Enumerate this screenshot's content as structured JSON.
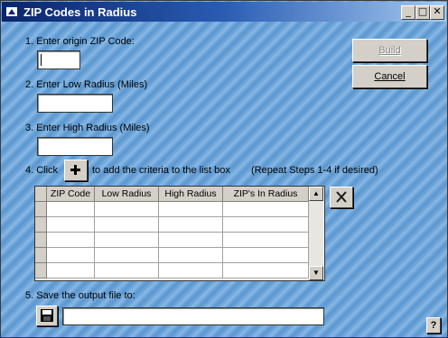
{
  "window": {
    "title": "ZIP Codes in Radius"
  },
  "titlebar_buttons": {
    "minimize": "_",
    "maximize": "□",
    "close": "✕"
  },
  "steps": {
    "step1": "1. Enter origin ZIP Code:",
    "step2": "2. Enter Low Radius (Miles)",
    "step3": "3. Enter High Radius (Miles)",
    "step4_prefix": "4. Click",
    "step4_suffix": "to add the criteria to the list box",
    "step4_repeat": "(Repeat Steps 1-4 if desired)",
    "step5": "5. Save the output file to:"
  },
  "inputs": {
    "origin_zip": "",
    "low_radius": "",
    "high_radius": "",
    "output_file": ""
  },
  "buttons": {
    "build": "Build",
    "cancel": "Cancel",
    "help": "?"
  },
  "grid": {
    "columns": [
      "ZIP Code",
      "Low Radius",
      "High Radius",
      "ZIP's In Radius"
    ],
    "rows": [
      [
        "",
        "",
        "",
        ""
      ],
      [
        "",
        "",
        "",
        ""
      ],
      [
        "",
        "",
        "",
        ""
      ],
      [
        "",
        "",
        "",
        ""
      ],
      [
        "",
        "",
        "",
        ""
      ]
    ]
  },
  "icons": {
    "add": "plus-icon",
    "remove": "x-icon",
    "save": "floppy-disk-icon",
    "scroll_up": "▲",
    "scroll_down": "▼"
  }
}
